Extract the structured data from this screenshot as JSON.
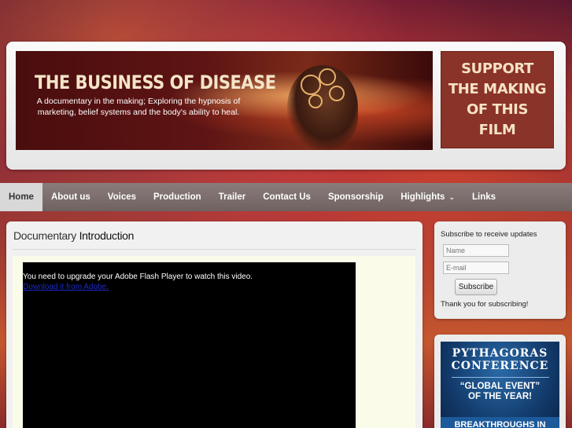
{
  "header": {
    "banner_title": "THE BUSINESS OF DISEASE",
    "banner_subtitle": "A documentary in the making; Exploring the hypnosis of marketing, belief systems and the body's ability to heal.",
    "support_text": "SUPPORT THE MAKING OF THIS FILM"
  },
  "nav": {
    "items": [
      {
        "label": "Home",
        "active": true
      },
      {
        "label": "About us"
      },
      {
        "label": "Voices"
      },
      {
        "label": "Production"
      },
      {
        "label": "Trailer"
      },
      {
        "label": "Contact Us"
      },
      {
        "label": "Sponsorship"
      },
      {
        "label": "Highlights",
        "icon": "chevron-down-icon"
      },
      {
        "label": "Links"
      }
    ]
  },
  "main": {
    "title_light": "Documentary",
    "title_bold": "Introduction",
    "video": {
      "message": "You need to upgrade your Adobe Flash Player to watch this video.",
      "link": "Download it from Adobe."
    }
  },
  "sidebar": {
    "subscribe": {
      "label": "Subscribe to receive updates",
      "name_placeholder": "Name",
      "email_placeholder": "E-mail",
      "button": "Subscribe",
      "thanks": "Thank you for subscribing!"
    },
    "ad": {
      "line1": "PYTHAGORAS",
      "line2": "CONFERENCE",
      "tag1": "“GLOBAL EVENT”",
      "tag2": "OF THE YEAR!",
      "strip": "BREAKTHROUGHS IN"
    }
  },
  "colors": {
    "nav_bg": "#7a6e6c",
    "support_bg": "#8a3328",
    "page_bg": "#f1f1f1"
  }
}
